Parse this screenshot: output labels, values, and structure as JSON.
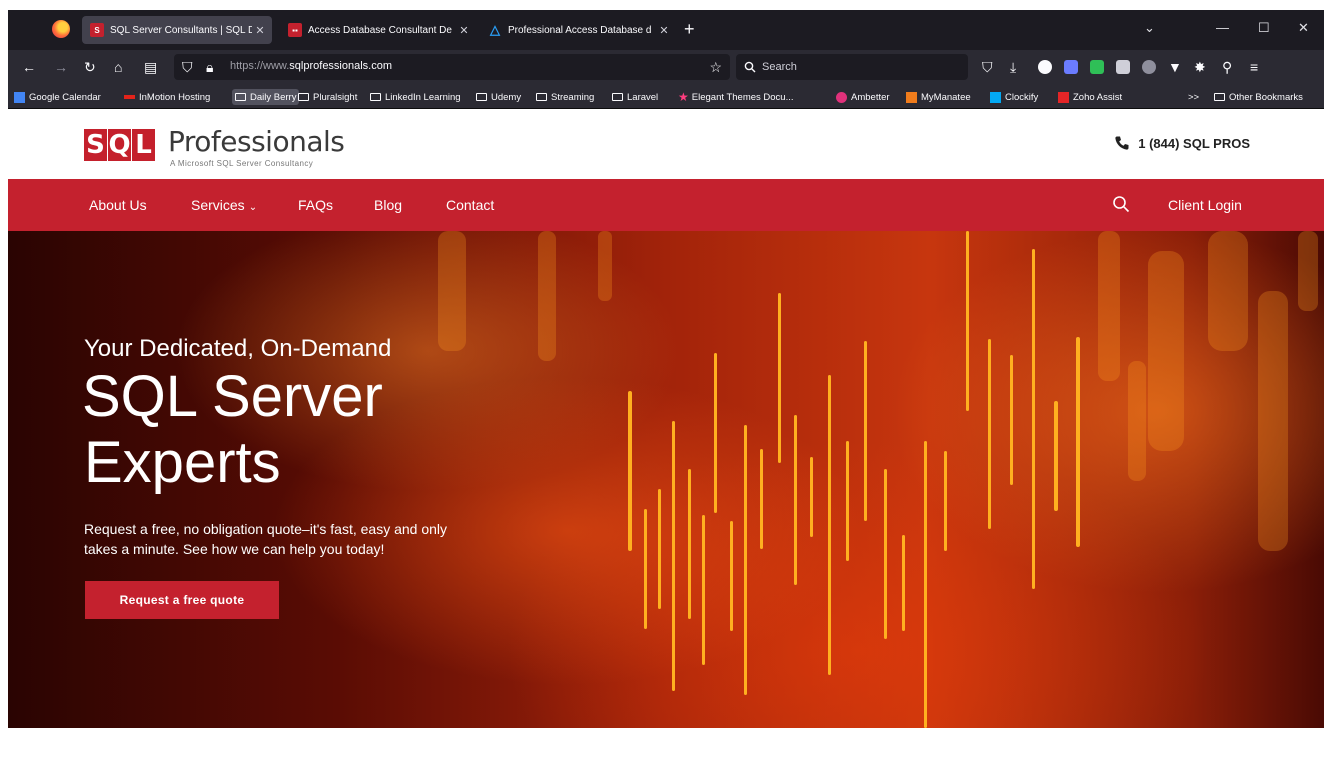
{
  "browser": {
    "tabs": [
      {
        "title": "SQL Server Consultants | SQL DBA C",
        "favicon": "sqlpros-favicon",
        "active": true
      },
      {
        "title": "Access Database Consultant De",
        "favicon": "access-favicon",
        "active": false
      },
      {
        "title": "Professional Access Database d",
        "favicon": "triangle-favicon",
        "active": false
      }
    ],
    "new_tab": "+",
    "url_dim": "https://www.",
    "url_main": "sqlprofessionals.com",
    "search_placeholder": "Search",
    "bookmarks": [
      {
        "label": "Google Calendar",
        "type": "icon",
        "color": "#4285f4"
      },
      {
        "label": "InMotion Hosting",
        "type": "icon",
        "color": "#e2231a"
      },
      {
        "label": "Daily Berry",
        "type": "folder",
        "highlighted": true
      },
      {
        "label": "Pluralsight",
        "type": "folder"
      },
      {
        "label": "LinkedIn Learning",
        "type": "folder"
      },
      {
        "label": "Udemy",
        "type": "folder"
      },
      {
        "label": "Streaming",
        "type": "folder"
      },
      {
        "label": "Laravel",
        "type": "folder"
      },
      {
        "label": "Elegant Themes Docu...",
        "type": "icon",
        "color": "#ff3d7f"
      },
      {
        "label": "Ambetter",
        "type": "icon",
        "color": "#e0317b"
      },
      {
        "label": "MyManatee",
        "type": "icon",
        "color": "#f07c1c"
      },
      {
        "label": "Clockify",
        "type": "icon",
        "color": "#03a9f4"
      },
      {
        "label": "Zoho Assist",
        "type": "icon",
        "color": "#e42527"
      }
    ],
    "overflow": ">>",
    "other_bookmarks": "Other Bookmarks"
  },
  "site": {
    "logo_mark": [
      "S",
      "Q",
      "L"
    ],
    "logo_name": "Professionals",
    "logo_tagline": "A Microsoft SQL Server Consultancy",
    "phone": "1 (844) SQL PROS",
    "nav": [
      "About Us",
      "Services",
      "FAQs",
      "Blog",
      "Contact"
    ],
    "client_login": "Client Login",
    "brand_color": "#c4212e"
  },
  "hero": {
    "pre_title": "Your Dedicated, On-Demand",
    "title_line1": "SQL Server",
    "title_line2": "Experts",
    "description": "Request a free, no obligation quote–it's fast, easy and only takes a minute. See how we can help you today!",
    "cta": "Request a free quote"
  }
}
